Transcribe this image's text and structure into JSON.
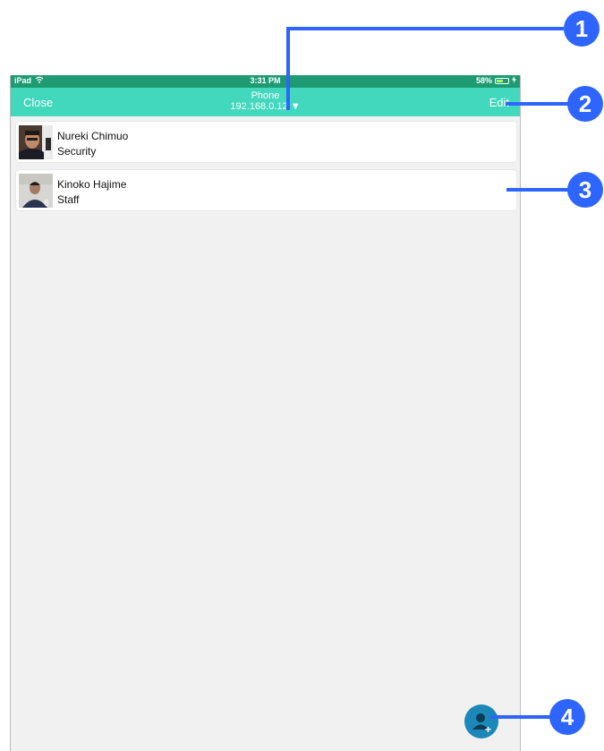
{
  "status_bar": {
    "device": "iPad",
    "time": "3:31 PM",
    "battery": "58%",
    "battery_level": 0.58
  },
  "nav": {
    "close_label": "Close",
    "title": "Phone",
    "subtitle": "192.168.0.12",
    "dropdown_glyph": "▼",
    "edit_label": "Edit"
  },
  "contacts": [
    {
      "name": "Nureki Chimuo",
      "role": "Security"
    },
    {
      "name": "Kinoko Hajime",
      "role": "Staff"
    }
  ],
  "fab": {
    "icon": "add-user-icon"
  },
  "callouts": [
    "1",
    "2",
    "3",
    "4"
  ],
  "colors": {
    "status_bar": "#1f9b74",
    "nav_bar": "#42d8bd",
    "callout": "#2e64ff",
    "fab": "#1b88b8",
    "background": "#f1f1f1"
  }
}
